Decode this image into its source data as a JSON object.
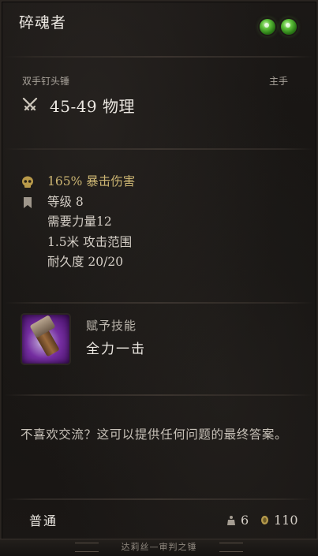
{
  "item": {
    "name": "碎魂者",
    "subtype": "双手钉头锤",
    "slot": "主手",
    "damage": "45-49 物理"
  },
  "stats": {
    "crit": "165% 暴击伤害",
    "level": "等级 8",
    "strength": "需要力量12",
    "range": "1.5米 攻击范围",
    "durability": "耐久度 20/20"
  },
  "skill": {
    "label": "赋予技能",
    "name": "全力一击",
    "icon": "power-strike-icon"
  },
  "description": "不喜欢交流？这可以提供任何问题的最终答案。",
  "footer": {
    "rarity": "普通",
    "weight": "6",
    "value": "110"
  },
  "bottom_text": "达莉丝—审判之锤",
  "colors": {
    "gem": "#5fc23c",
    "crit_text": "#cbb472",
    "skill_glow": "#a046d2"
  }
}
